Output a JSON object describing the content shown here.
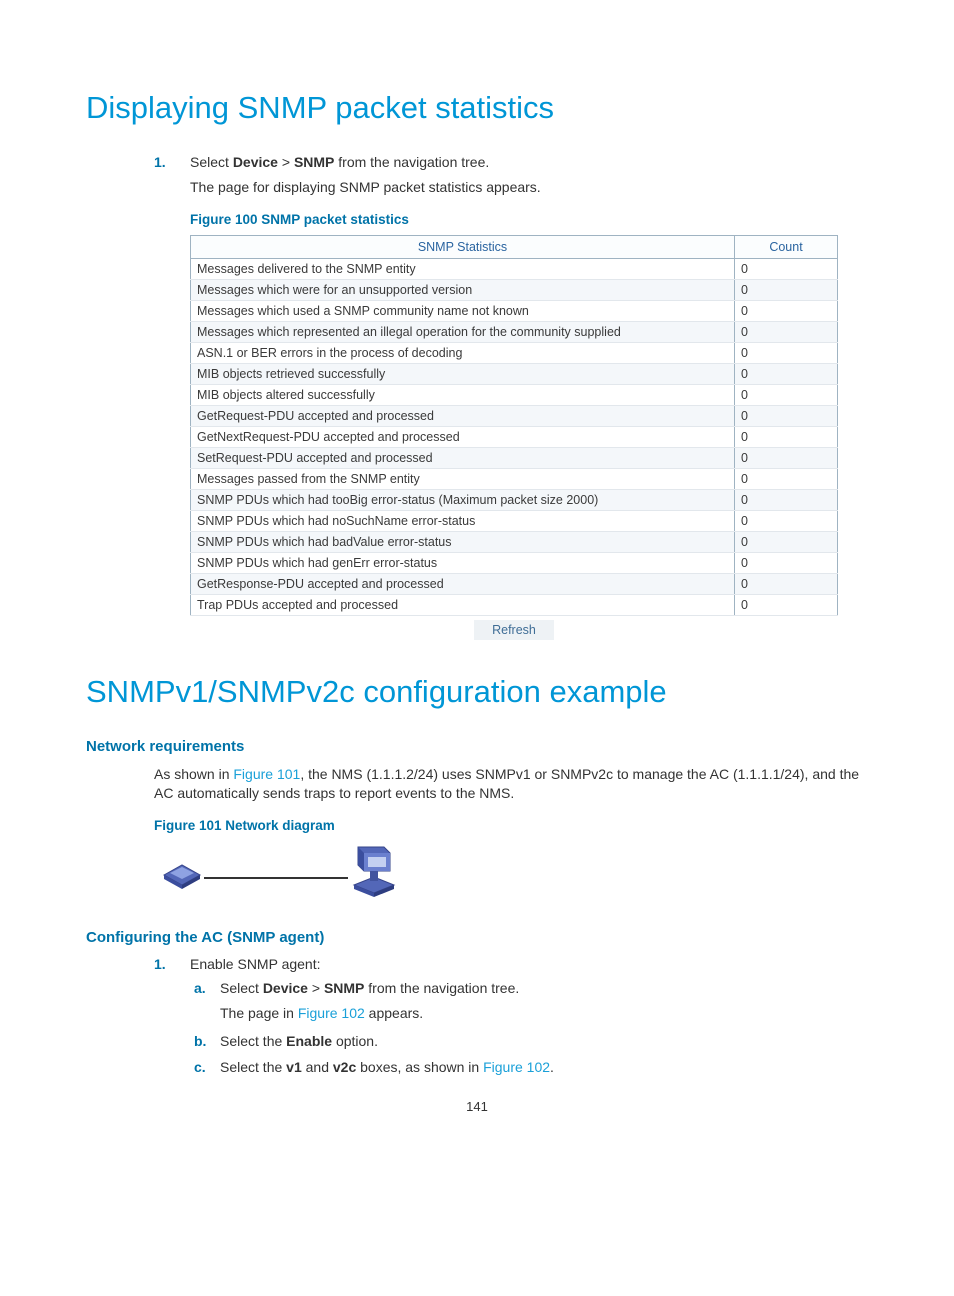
{
  "heading1": "Displaying SNMP packet statistics",
  "step1_num": "1.",
  "step1_prefix": "Select ",
  "step1_device": "Device",
  "step1_gt": " > ",
  "step1_snmp": "SNMP",
  "step1_suffix": " from the navigation tree.",
  "step1_desc": "The page for displaying SNMP packet statistics appears.",
  "figure100": "Figure 100 SNMP packet statistics",
  "table": {
    "col_stats": "SNMP Statistics",
    "col_count": "Count",
    "rows": [
      {
        "label": "Messages delivered to the SNMP entity",
        "count": "0"
      },
      {
        "label": "Messages which were for an unsupported version",
        "count": "0"
      },
      {
        "label": "Messages which used a SNMP community name not known",
        "count": "0"
      },
      {
        "label": "Messages which represented an illegal operation for the community supplied",
        "count": "0"
      },
      {
        "label": "ASN.1 or BER errors in the process of decoding",
        "count": "0"
      },
      {
        "label": "MIB objects retrieved successfully",
        "count": "0"
      },
      {
        "label": "MIB objects altered successfully",
        "count": "0"
      },
      {
        "label": "GetRequest-PDU accepted and processed",
        "count": "0"
      },
      {
        "label": "GetNextRequest-PDU accepted and processed",
        "count": "0"
      },
      {
        "label": "SetRequest-PDU accepted and processed",
        "count": "0"
      },
      {
        "label": "Messages passed from the SNMP entity",
        "count": "0"
      },
      {
        "label": "SNMP PDUs which had tooBig error-status (Maximum packet size 2000)",
        "count": "0"
      },
      {
        "label": "SNMP PDUs which had noSuchName error-status",
        "count": "0"
      },
      {
        "label": "SNMP PDUs which had badValue error-status",
        "count": "0"
      },
      {
        "label": "SNMP PDUs which had genErr error-status",
        "count": "0"
      },
      {
        "label": "GetResponse-PDU accepted and processed",
        "count": "0"
      },
      {
        "label": "Trap PDUs accepted and processed",
        "count": "0"
      }
    ]
  },
  "refresh": "Refresh",
  "heading2": "SNMPv1/SNMPv2c configuration example",
  "netreq_heading": "Network requirements",
  "netreq_prefix": "As shown in ",
  "netreq_link": "Figure 101",
  "netreq_suffix": ", the NMS (1.1.1.2/24) uses SNMPv1 or SNMPv2c to manage the AC (1.1.1.1/24), and the AC automatically sends traps to report events to the NMS.",
  "figure101": "Figure 101 Network diagram",
  "confac_heading": "Configuring the AC (SNMP agent)",
  "cf_step1_num": "1.",
  "cf_step1_text": "Enable SNMP agent:",
  "cf_a_letter": "a.",
  "cf_a_prefix": "Select ",
  "cf_a_device": "Device",
  "cf_a_gt": " > ",
  "cf_a_snmp": "SNMP",
  "cf_a_suffix": " from the navigation tree.",
  "cf_a_desc_prefix": "The page in ",
  "cf_a_desc_link": "Figure 102",
  "cf_a_desc_suffix": " appears.",
  "cf_b_letter": "b.",
  "cf_b_prefix": "Select the ",
  "cf_b_bold": "Enable",
  "cf_b_suffix": " option.",
  "cf_c_letter": "c.",
  "cf_c_prefix": "Select the ",
  "cf_c_v1": "v1",
  "cf_c_and": " and ",
  "cf_c_v2c": "v2c",
  "cf_c_mid": " boxes, as shown in ",
  "cf_c_link": "Figure 102",
  "cf_c_suffix": ".",
  "page_number": "141"
}
